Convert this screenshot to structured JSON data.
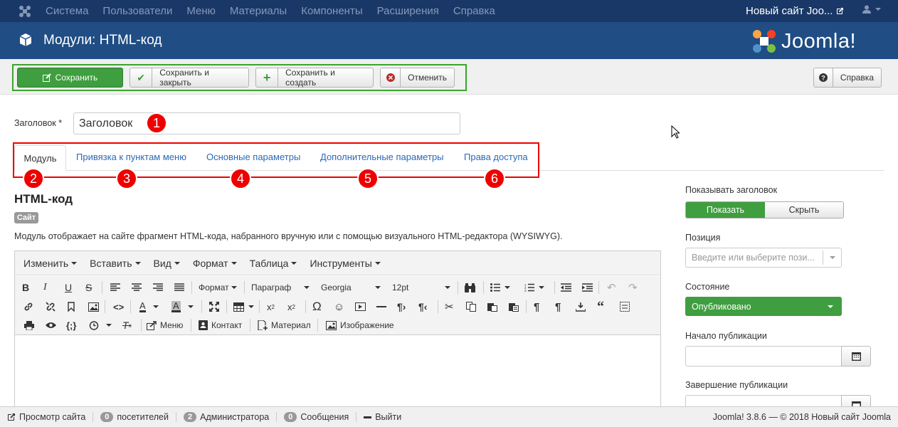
{
  "topnav": {
    "menu": [
      "Система",
      "Пользователи",
      "Меню",
      "Материалы",
      "Компоненты",
      "Расширения",
      "Справка"
    ],
    "site_link": "Новый сайт Joo..."
  },
  "titlebar": {
    "title": "Модули: HTML-код",
    "brand": "Joomla!"
  },
  "toolbar": {
    "save": "Сохранить",
    "save_close": "Сохранить и закрыть",
    "save_new": "Сохранить и создать",
    "cancel": "Отменить",
    "help": "Справка"
  },
  "form": {
    "title_label": "Заголовок *",
    "title_value": "Заголовок"
  },
  "tabs": [
    "Модуль",
    "Привязка к пунктам меню",
    "Основные параметры",
    "Дополнительные параметры",
    "Права доступа"
  ],
  "badges": [
    "1",
    "2",
    "3",
    "4",
    "5",
    "6"
  ],
  "module": {
    "heading": "HTML-код",
    "site_badge": "Сайт",
    "description": "Модуль отображает на сайте фрагмент HTML-кода, набранного вручную или с помощью визуального HTML-редактора (WYSIWYG)."
  },
  "editor": {
    "menu": [
      "Изменить",
      "Вставить",
      "Вид",
      "Формат",
      "Таблица",
      "Инструменты"
    ],
    "format_select": "Формат",
    "paragraph_select": "Параграф",
    "font_select": "Georgia",
    "size_select": "12pt",
    "btn_menu": "Меню",
    "btn_contact": "Контакт",
    "btn_article": "Материал",
    "btn_image": "Изображение"
  },
  "right_panel": {
    "show_title_label": "Показывать заголовок",
    "show": "Показать",
    "hide": "Скрыть",
    "position_label": "Позиция",
    "position_placeholder": "Введите или выберите пози...",
    "status_label": "Состояние",
    "status_value": "Опубликовано",
    "publish_start_label": "Начало публикации",
    "publish_end_label": "Завершение публикации"
  },
  "statusbar": {
    "preview": "Просмотр сайта",
    "visitors_count": "0",
    "visitors": "посетителей",
    "admins_count": "2",
    "admins": "Администратора",
    "messages_count": "0",
    "messages": "Сообщения",
    "logout": "Выйти",
    "version": "Joomla! 3.8.6  —  © 2018 Новый сайт Joomla"
  },
  "colors": {
    "nav": "#1a3867",
    "header": "#1f4d84",
    "success": "#3f9e3f",
    "annotation": "#e00000",
    "toolbar_highlight": "#3aa52a"
  }
}
